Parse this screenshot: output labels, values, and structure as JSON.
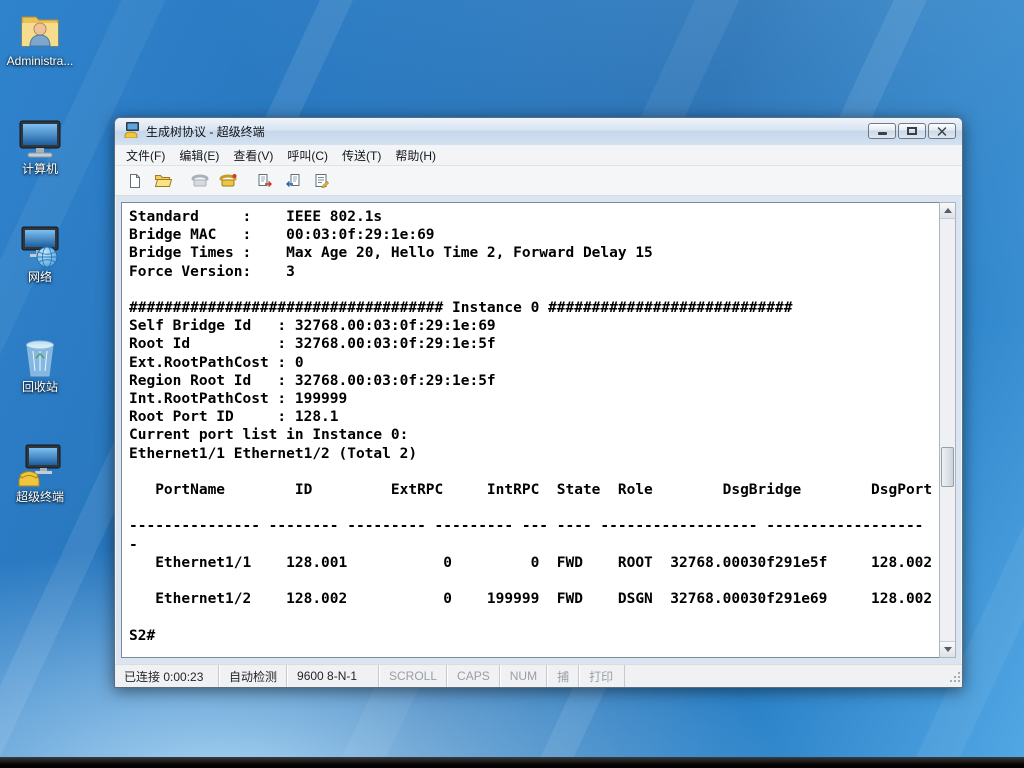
{
  "colors": {
    "desktop_blue": "#2673ba",
    "window_frame": "#dbe5f1",
    "terminal_bg": "#ffffff",
    "terminal_fg": "#000000",
    "taskbar_black": "#060606"
  },
  "desktop": {
    "icons": [
      {
        "id": "administrator",
        "label": "Administra..."
      },
      {
        "id": "computer",
        "label": "计算机"
      },
      {
        "id": "network",
        "label": "网络"
      },
      {
        "id": "recycle-bin",
        "label": "回收站"
      },
      {
        "id": "hyperterminal",
        "label": "超级终端"
      }
    ]
  },
  "window": {
    "title": "生成树协议 - 超级终端",
    "controls": [
      "minimize",
      "maximize",
      "close"
    ],
    "menu": [
      "文件(F)",
      "编辑(E)",
      "查看(V)",
      "呼叫(C)",
      "传送(T)",
      "帮助(H)"
    ],
    "toolbar_icons": [
      "new-icon",
      "open-icon",
      "call-icon",
      "hangup-icon",
      "send-icon",
      "receive-icon",
      "properties-icon"
    ],
    "terminal": {
      "lines": [
        "Standard     :    IEEE 802.1s",
        "Bridge MAC   :    00:03:0f:29:1e:69",
        "Bridge Times :    Max Age 20, Hello Time 2, Forward Delay 15",
        "Force Version:    3",
        "",
        "#################################### Instance 0 ############################",
        "Self Bridge Id   : 32768.00:03:0f:29:1e:69",
        "Root Id          : 32768.00:03:0f:29:1e:5f",
        "Ext.RootPathCost : 0",
        "Region Root Id   : 32768.00:03:0f:29:1e:5f",
        "Int.RootPathCost : 199999",
        "Root Port ID     : 128.1",
        "Current port list in Instance 0:",
        "Ethernet1/1 Ethernet1/2 (Total 2)",
        "",
        "   PortName        ID         ExtRPC     IntRPC  State  Role        DsgBridge        DsgPort",
        "",
        "--------------- -------- --------- --------- --- ---- ------------------ ------------------",
        "-",
        "   Ethernet1/1    128.001           0         0  FWD    ROOT  32768.00030f291e5f     128.002",
        "",
        "   Ethernet1/2    128.002           0    199999  FWD    DSGN  32768.00030f291e69     128.002",
        "",
        "S2#"
      ]
    },
    "status": {
      "connection": "已连接 0:00:23",
      "autodetect": "自动检测",
      "baud": "9600 8-N-1",
      "scroll": "SCROLL",
      "caps": "CAPS",
      "num": "NUM",
      "capture": "捕",
      "print": "打印"
    }
  }
}
